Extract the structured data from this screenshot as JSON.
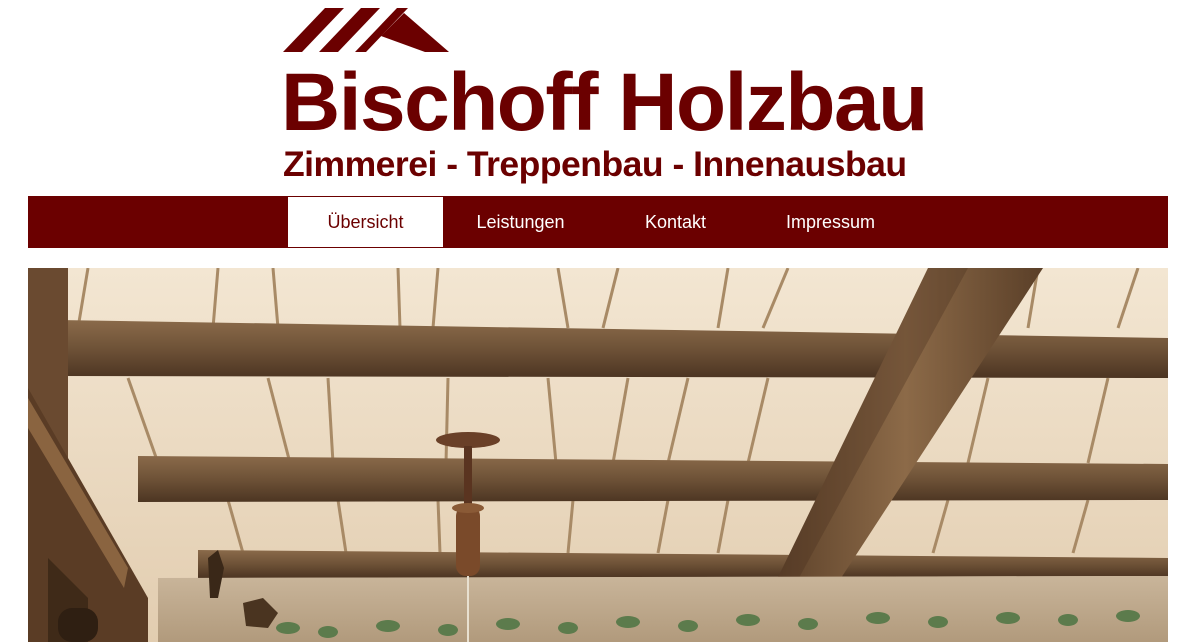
{
  "logo": {
    "name": "Bischoff Holzbau",
    "tagline": "Zimmerei - Treppenbau - Innenausbau"
  },
  "nav": {
    "items": [
      {
        "label": "Übersicht",
        "active": true
      },
      {
        "label": "Leistungen",
        "active": false
      },
      {
        "label": "Kontakt",
        "active": false
      },
      {
        "label": "Impressum",
        "active": false
      }
    ]
  },
  "colors": {
    "brand": "#6b0000",
    "background": "#ffffff",
    "nav_text": "#ffffff"
  }
}
